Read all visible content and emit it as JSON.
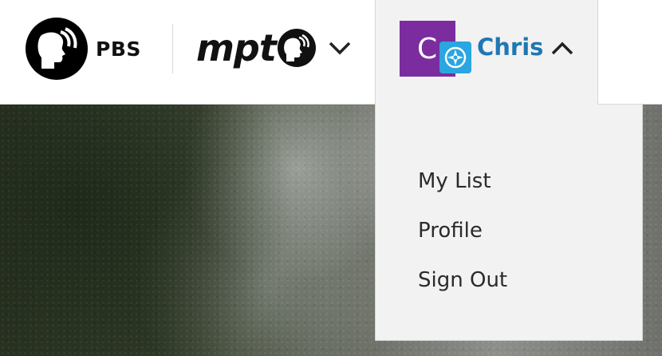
{
  "brand": {
    "logo_text": "PBS",
    "icon": "pbs-heads-icon"
  },
  "station": {
    "name": "mpt",
    "icon": "mpt-pbs-heads-icon",
    "toggle_icon": "chevron-down-icon"
  },
  "user": {
    "avatar_initial": "C",
    "name": "Chris",
    "badge_icon": "passport-compass-icon",
    "toggle_icon": "chevron-up-icon",
    "avatar_color": "#7b2d9f",
    "name_color": "#1f77b4"
  },
  "dropdown": {
    "items": [
      {
        "label": "My List"
      },
      {
        "label": "Profile"
      },
      {
        "label": "Sign Out"
      }
    ]
  }
}
